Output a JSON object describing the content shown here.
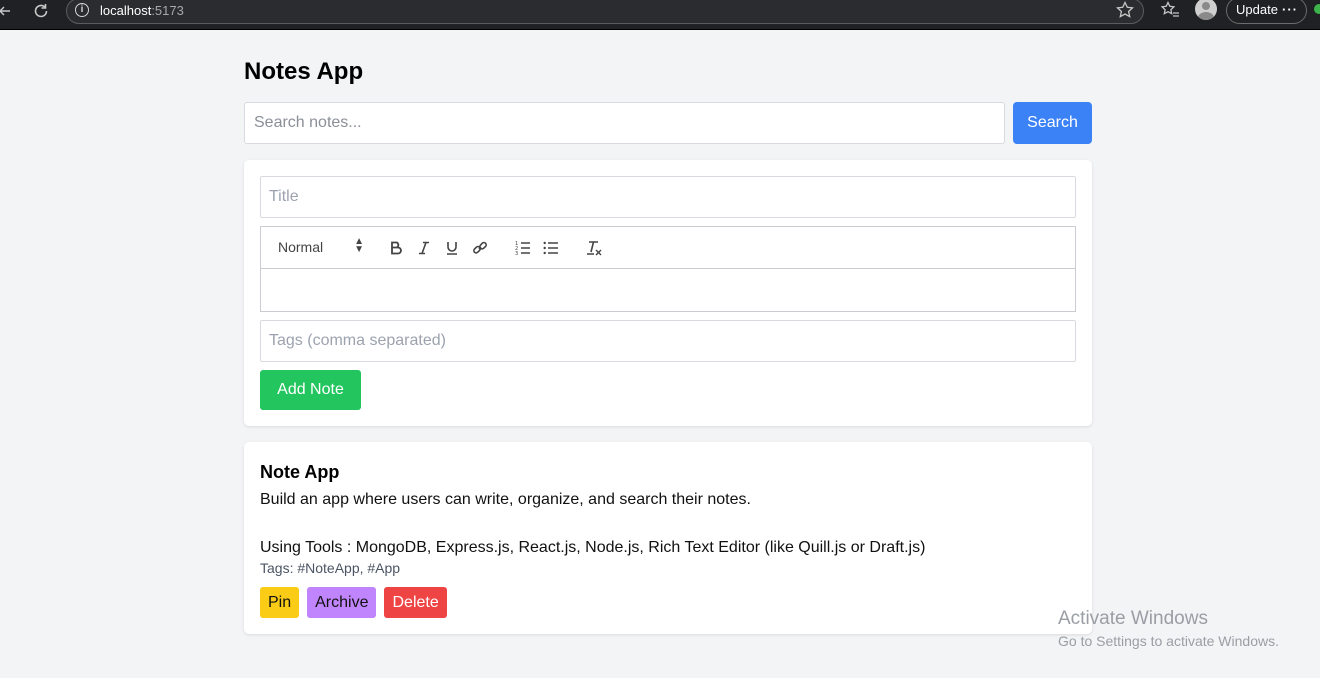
{
  "browser": {
    "url_host": "localhost",
    "url_port": ":5173",
    "update_label": "Update",
    "menu_label": "···"
  },
  "app": {
    "title": "Notes App"
  },
  "search": {
    "placeholder": "Search notes...",
    "button_label": "Search"
  },
  "form": {
    "title_placeholder": "Title",
    "format_select_value": "Normal",
    "toolbar_icons": [
      "bold-icon",
      "italic-icon",
      "underline-icon",
      "link-icon",
      "ordered-list-icon",
      "bullet-list-icon",
      "clear-format-icon"
    ],
    "tags_placeholder": "Tags (comma separated)",
    "add_button_label": "Add Note"
  },
  "notes": [
    {
      "title": "Note App",
      "body_line1": "Build an app where users can write, organize, and search their notes.",
      "body_line2": "Using Tools : MongoDB, Express.js, React.js, Node.js, Rich Text Editor (like Quill.js or Draft.js)",
      "tags_text": "Tags: #NoteApp, #App",
      "pin_label": "Pin",
      "archive_label": "Archive",
      "delete_label": "Delete"
    }
  ],
  "colors": {
    "search_button": "#3b82f6",
    "add_button": "#22c55e",
    "pin_button": "#facc15",
    "archive_button": "#c084fc",
    "delete_button": "#ef4444"
  },
  "watermark": {
    "line1": "Activate Windows",
    "line2": "Go to Settings to activate Windows."
  }
}
